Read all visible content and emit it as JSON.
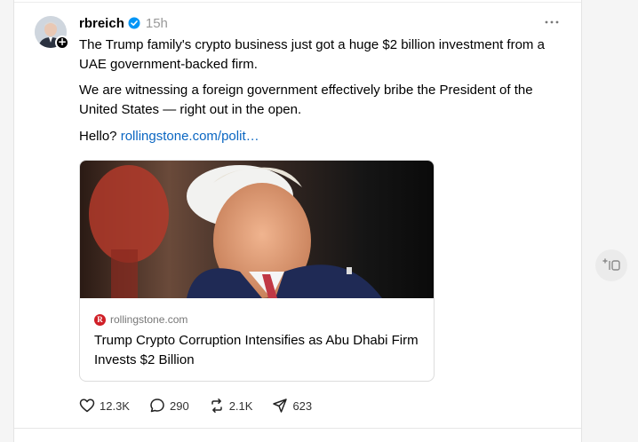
{
  "post": {
    "username": "rbreich",
    "timestamp": "15h",
    "paragraph1": "The Trump family's crypto business just got a huge $2 billion investment from a UAE government-backed firm.",
    "paragraph2": "We are witnessing a foreign government effectively bribe the President of the United States — right out in the open.",
    "paragraph3_prefix": "Hello?",
    "link_text": "rollingstone.com/polit…",
    "icons": {
      "verified": "verified-badge-icon",
      "follow": "plus-icon",
      "more": "more-dots-icon"
    }
  },
  "link_card": {
    "source_logo_letter": "R",
    "source_domain": "rollingstone.com",
    "title": "Trump Crypto Corruption Intensifies as Abu Dhabi Firm Invests $2 Billion",
    "image_icon": "article-photo"
  },
  "actions": {
    "likes": "12.3K",
    "replies": "290",
    "reposts": "2.1K",
    "shares": "623"
  },
  "colors": {
    "link": "#0a66c2",
    "verified": "#0095f6",
    "source_logo": "#d01f27"
  }
}
